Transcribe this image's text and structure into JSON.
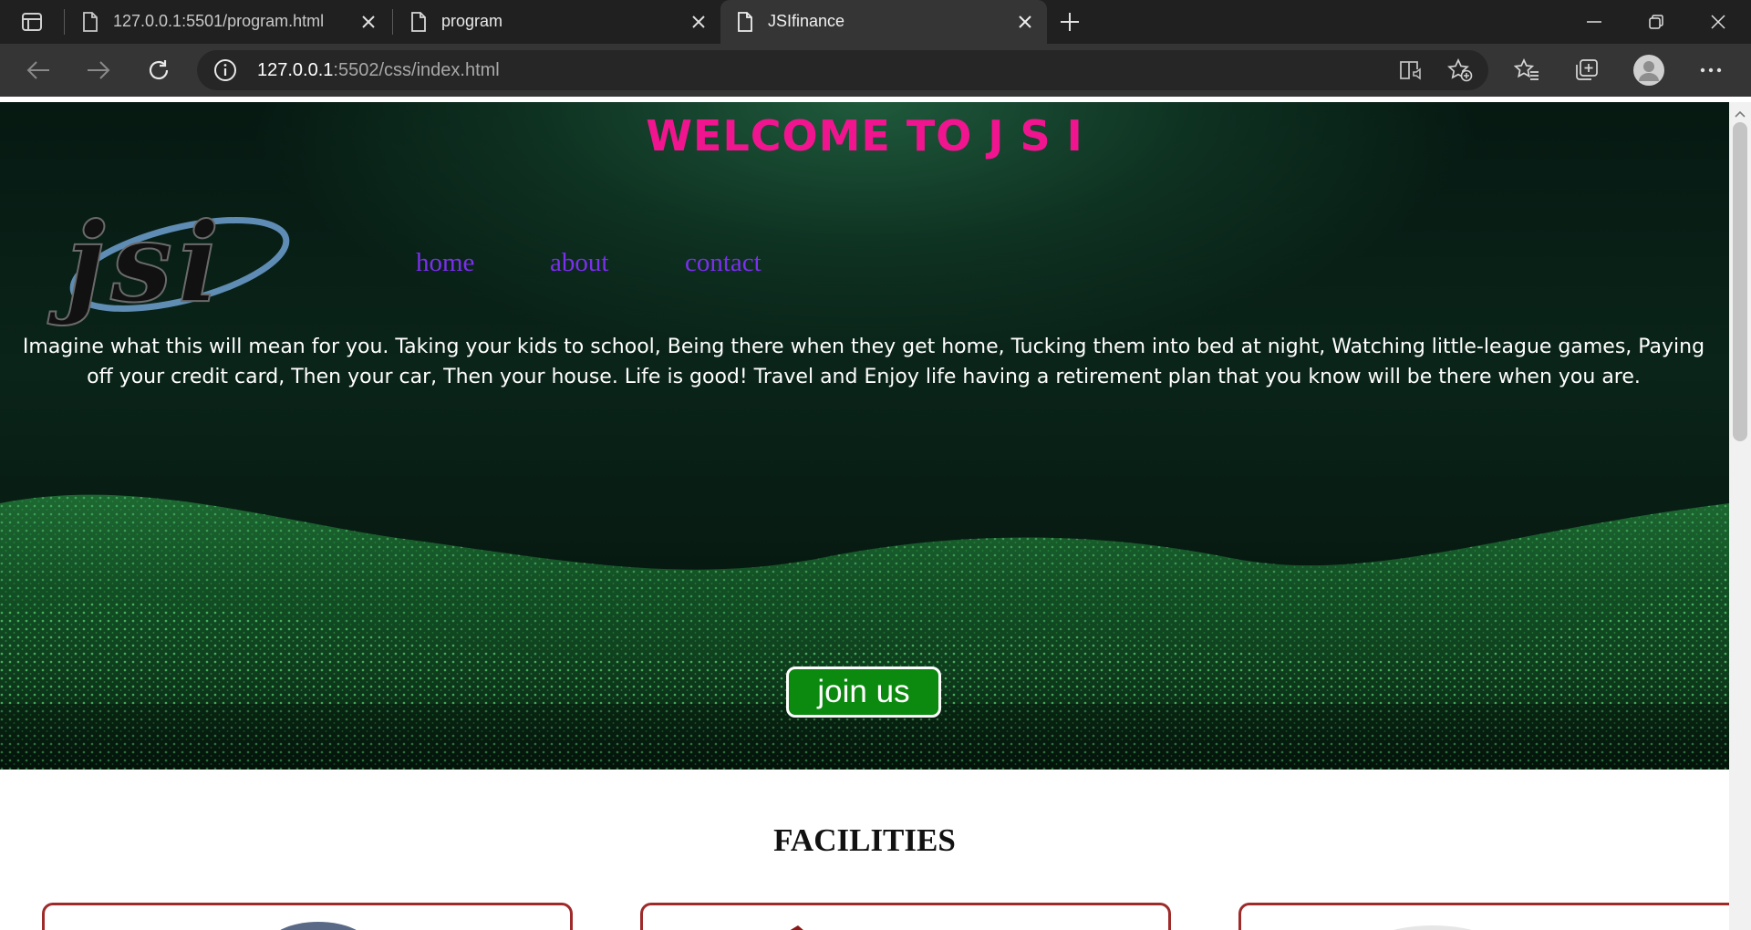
{
  "browser": {
    "tabs": [
      {
        "title": "127.0.0.1:5501/program.html",
        "active": false
      },
      {
        "title": "program",
        "active": false
      },
      {
        "title": "JSIfinance",
        "active": true
      }
    ],
    "url_host": "127.0.0.1",
    "url_rest": ":5502/css/index.html"
  },
  "hero": {
    "title": "WELCOME TO J S I",
    "logo_text": "jsi",
    "nav": [
      "home",
      "about",
      "contact"
    ],
    "text": "Imagine what this will mean for you. Taking your kids to school, Being there when they get home, Tucking them into bed at night, Watching little-league games, Paying off your credit card, Then your car, Then your house. Life is good! Travel and Enjoy life having a retirement plan that you know will be there when you are.",
    "cta": "join us"
  },
  "facilities": {
    "title": "FACILITIES",
    "cards": 3
  },
  "colors": {
    "title": "#f0158f",
    "nav": "#7b2ff0",
    "cta_bg": "#0c8a10",
    "card_border": "#9e2a2a"
  }
}
